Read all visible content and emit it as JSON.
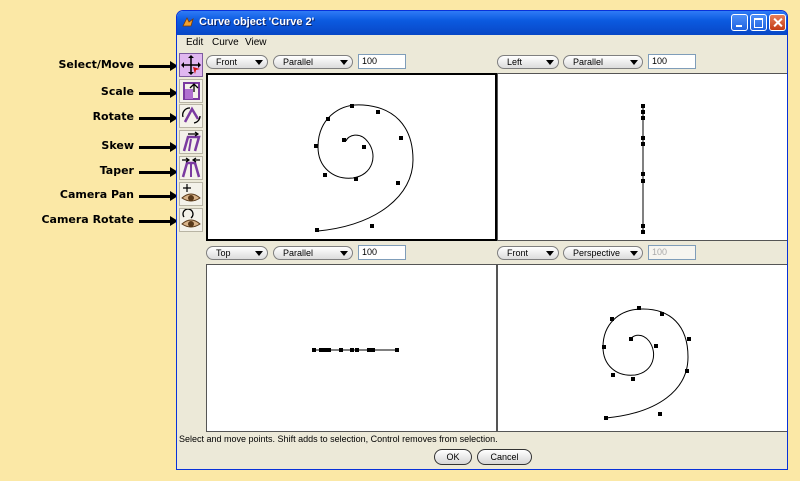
{
  "callouts": {
    "select_move": "Select/Move",
    "scale": "Scale",
    "rotate": "Rotate",
    "skew": "Skew",
    "taper": "Taper",
    "camera_pan": "Camera Pan",
    "camera_rotate": "Camera Rotate"
  },
  "window": {
    "title": "Curve object 'Curve 2'"
  },
  "menu": {
    "edit": "Edit",
    "curve": "Curve",
    "view": "View"
  },
  "tools": [
    "select-move-icon",
    "scale-icon",
    "rotate-icon",
    "skew-icon",
    "taper-icon",
    "camera-pan-icon",
    "camera-rotate-icon"
  ],
  "views": {
    "top_left": {
      "direction": "Front",
      "projection": "Parallel",
      "scale": "100"
    },
    "top_right": {
      "direction": "Left",
      "projection": "Parallel",
      "scale": "100"
    },
    "bottom_left": {
      "direction": "Top",
      "projection": "Parallel",
      "scale": "100"
    },
    "bottom_right": {
      "direction": "Front",
      "projection": "Perspective",
      "scale": "100"
    }
  },
  "status_text": "Select and move points.  Shift adds to selection, Control removes from selection.",
  "buttons": {
    "ok": "OK",
    "cancel": "Cancel"
  },
  "colors": {
    "selected_tool": "#e0b7f0",
    "title_bar": "#0b5ae0",
    "background": "#fbe8a6"
  }
}
